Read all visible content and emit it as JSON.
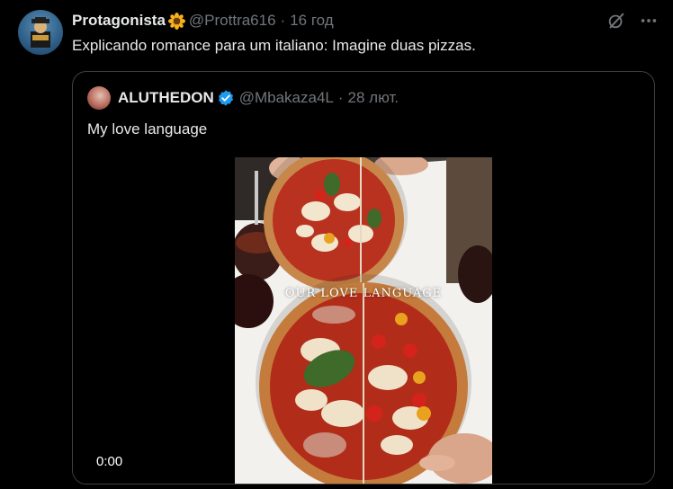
{
  "tweet": {
    "display_name": "Protagonista",
    "name_emoji": "sunflower-icon",
    "handle": "@Prottra616",
    "separator": "·",
    "time": "16 год",
    "text": "Explicando romance para um italiano: Imagine duas pizzas."
  },
  "quote": {
    "display_name": "ALUTHEDON",
    "verified": true,
    "handle": "@Mbakaza4L",
    "separator": "·",
    "time": "28 лют.",
    "text": "My love language",
    "video": {
      "overlay_text": "OUR LOVE LANGUAGE",
      "timestamp": "0:00"
    }
  },
  "colors": {
    "background": "#000000",
    "text_primary": "#e7e9ea",
    "text_secondary": "#71767b",
    "border": "#3d4145",
    "verified_blue": "#1d9bf0"
  }
}
